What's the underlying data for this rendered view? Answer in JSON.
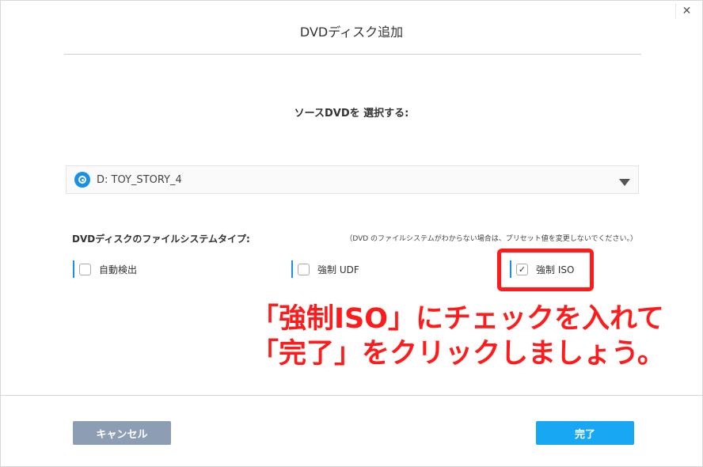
{
  "dialog": {
    "title": "DVDディスク追加",
    "close_glyph": "✕"
  },
  "source": {
    "label": "ソースDVDを 選択する:",
    "selected_drive": "D: TOY_STORY_4"
  },
  "filesystem": {
    "label": "DVDディスクのファイルシステムタイプ:",
    "note": "（DVD のファイルシステムがわからない場合は、プリセット値を変更しないでください。）",
    "options": [
      {
        "label": "自動検出",
        "checked": false
      },
      {
        "label": "強制 UDF",
        "checked": false
      },
      {
        "label": "強制 ISO",
        "checked": true
      }
    ],
    "check_glyph": "✓"
  },
  "annotation": {
    "line1": "「強制ISO」にチェックを入れて",
    "line2": "「完了」をクリックしましょう。",
    "color": "#ff1b1b"
  },
  "buttons": {
    "cancel": "キャンセル",
    "done": "完了"
  },
  "colors": {
    "accent": "#1a8fe6",
    "done_button": "#17a7f3",
    "cancel_button": "#8d9db4"
  }
}
